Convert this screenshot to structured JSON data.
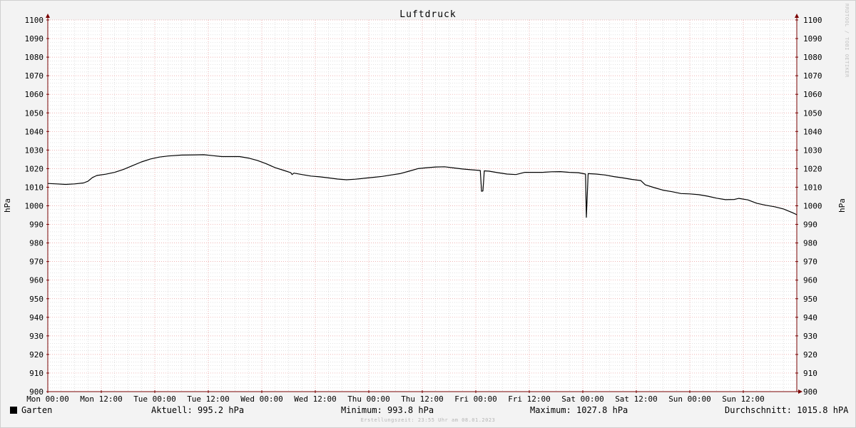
{
  "colors": {
    "background": "#f3f3f3",
    "canvas": "#ffffff",
    "major_grid": "#e89898",
    "minor_grid": "#cfcfcf",
    "axis": "#7a0000",
    "line": "#000000"
  },
  "chart_data": {
    "type": "line",
    "title": "Luftdruck",
    "ylabel": "hPa",
    "ylabel_right": "hPa",
    "ylim": [
      900,
      1100
    ],
    "yticks": [
      900,
      910,
      920,
      930,
      940,
      950,
      960,
      970,
      980,
      990,
      1000,
      1010,
      1020,
      1030,
      1040,
      1050,
      1060,
      1070,
      1080,
      1090,
      1100
    ],
    "xlim": [
      0,
      168
    ],
    "xticks": [
      {
        "x": 0,
        "label": "Mon 00:00"
      },
      {
        "x": 12,
        "label": "Mon 12:00"
      },
      {
        "x": 24,
        "label": "Tue 00:00"
      },
      {
        "x": 36,
        "label": "Tue 12:00"
      },
      {
        "x": 48,
        "label": "Wed 00:00"
      },
      {
        "x": 60,
        "label": "Wed 12:00"
      },
      {
        "x": 72,
        "label": "Thu 00:00"
      },
      {
        "x": 84,
        "label": "Thu 12:00"
      },
      {
        "x": 96,
        "label": "Fri 00:00"
      },
      {
        "x": 108,
        "label": "Fri 12:00"
      },
      {
        "x": 120,
        "label": "Sat 00:00"
      },
      {
        "x": 132,
        "label": "Sat 12:00"
      },
      {
        "x": 144,
        "label": "Sun 00:00"
      },
      {
        "x": 156,
        "label": "Sun 12:00"
      }
    ],
    "grid": true,
    "series": [
      {
        "name": "Garten",
        "color": "#000000",
        "points": [
          [
            0,
            1012
          ],
          [
            2,
            1011.8
          ],
          [
            4,
            1011.5
          ],
          [
            6,
            1011.8
          ],
          [
            8,
            1012.3
          ],
          [
            9,
            1013.2
          ],
          [
            10,
            1015.2
          ],
          [
            11,
            1016.3
          ],
          [
            13,
            1017
          ],
          [
            15,
            1018
          ],
          [
            17,
            1019.6
          ],
          [
            19,
            1021.6
          ],
          [
            21,
            1023.6
          ],
          [
            23,
            1025.2
          ],
          [
            25,
            1026.2
          ],
          [
            27,
            1026.8
          ],
          [
            30,
            1027.3
          ],
          [
            33,
            1027.4
          ],
          [
            35,
            1027.5
          ],
          [
            37,
            1027
          ],
          [
            39,
            1026.5
          ],
          [
            41,
            1026.5
          ],
          [
            43,
            1026.5
          ],
          [
            45,
            1025.7
          ],
          [
            47,
            1024.4
          ],
          [
            49,
            1022.6
          ],
          [
            51,
            1020.5
          ],
          [
            53,
            1019
          ],
          [
            54.5,
            1017.8
          ],
          [
            54.8,
            1016.8
          ],
          [
            55.2,
            1017.6
          ],
          [
            57,
            1016.8
          ],
          [
            59,
            1016
          ],
          [
            61,
            1015.6
          ],
          [
            63,
            1015
          ],
          [
            65,
            1014.4
          ],
          [
            67,
            1014
          ],
          [
            69,
            1014.3
          ],
          [
            71,
            1014.8
          ],
          [
            73,
            1015.3
          ],
          [
            75,
            1015.8
          ],
          [
            77,
            1016.6
          ],
          [
            79,
            1017.3
          ],
          [
            81,
            1018.6
          ],
          [
            83,
            1020
          ],
          [
            85,
            1020.5
          ],
          [
            87,
            1020.9
          ],
          [
            89,
            1021
          ],
          [
            91,
            1020.4
          ],
          [
            93,
            1019.8
          ],
          [
            95,
            1019.4
          ],
          [
            97,
            1019
          ],
          [
            97.3,
            1007.8
          ],
          [
            97.6,
            1008
          ],
          [
            97.9,
            1018.8
          ],
          [
            99,
            1018.6
          ],
          [
            101,
            1017.8
          ],
          [
            103,
            1017.1
          ],
          [
            105,
            1016.8
          ],
          [
            107,
            1018
          ],
          [
            109,
            1018
          ],
          [
            111,
            1018
          ],
          [
            113,
            1018.3
          ],
          [
            115,
            1018.4
          ],
          [
            117,
            1018
          ],
          [
            119,
            1017.8
          ],
          [
            120.6,
            1017.1
          ],
          [
            120.8,
            993.8
          ],
          [
            121.2,
            1017.3
          ],
          [
            123,
            1017.1
          ],
          [
            125,
            1016.6
          ],
          [
            127,
            1015.7
          ],
          [
            129,
            1015
          ],
          [
            131,
            1014.2
          ],
          [
            133,
            1013.6
          ],
          [
            134,
            1011.3
          ],
          [
            136,
            1009.8
          ],
          [
            138,
            1008.4
          ],
          [
            140,
            1007.6
          ],
          [
            142,
            1006.6
          ],
          [
            144,
            1006.4
          ],
          [
            146,
            1006
          ],
          [
            148,
            1005.2
          ],
          [
            150,
            1004.1
          ],
          [
            152,
            1003.3
          ],
          [
            154,
            1003.4
          ],
          [
            155,
            1004
          ],
          [
            157,
            1003.2
          ],
          [
            159,
            1001.4
          ],
          [
            161,
            1000.3
          ],
          [
            163,
            999.5
          ],
          [
            165,
            998.3
          ],
          [
            167,
            996.3
          ],
          [
            168,
            995.2
          ]
        ]
      }
    ]
  },
  "legend": {
    "series_label": "Garten",
    "current": "Aktuell: 995.2 hPa",
    "minimum": "Minimum: 993.8 hPa",
    "maximum": "Maximum: 1027.8 hPa",
    "average": "Durchschnitt: 1015.8 hPA"
  },
  "footer_note": "Erstellungszeit: 23:55 Uhr am 08.01.2023",
  "watermark": "RRDTOOL / TOBI OETIKER"
}
